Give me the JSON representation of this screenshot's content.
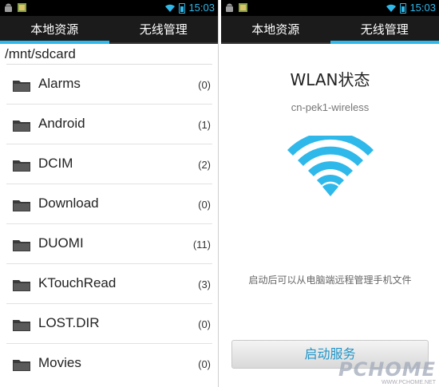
{
  "status_bar": {
    "time": "15:03"
  },
  "left_screen": {
    "tabs": [
      "本地资源",
      "无线管理"
    ],
    "active_tab": 0,
    "path": "/mnt/sdcard",
    "folders": [
      {
        "name": "Alarms",
        "count": "(0)"
      },
      {
        "name": "Android",
        "count": "(1)"
      },
      {
        "name": "DCIM",
        "count": "(2)"
      },
      {
        "name": "Download",
        "count": "(0)"
      },
      {
        "name": "DUOMI",
        "count": "(11)"
      },
      {
        "name": "KTouchRead",
        "count": "(3)"
      },
      {
        "name": "LOST.DIR",
        "count": "(0)"
      },
      {
        "name": "Movies",
        "count": "(0)"
      }
    ]
  },
  "right_screen": {
    "tabs": [
      "本地资源",
      "无线管理"
    ],
    "active_tab": 1,
    "title": "WLAN状态",
    "ssid": "cn-pek1-wireless",
    "hint": "启动后可以从电脑端远程管理手机文件",
    "start_button": "启动服务"
  },
  "watermark": {
    "brand": "PCHOME",
    "url": "WWW.PCHOME.NET"
  },
  "colors": {
    "accent": "#2fb8ea",
    "wifi": "#2fb8ea",
    "button_text": "#2196c9"
  },
  "icons": {
    "folder": "folder-icon",
    "wifi": "wifi-icon",
    "android": "android-icon",
    "gallery": "image-icon",
    "signal": "wifi-signal-icon",
    "battery": "battery-icon"
  }
}
